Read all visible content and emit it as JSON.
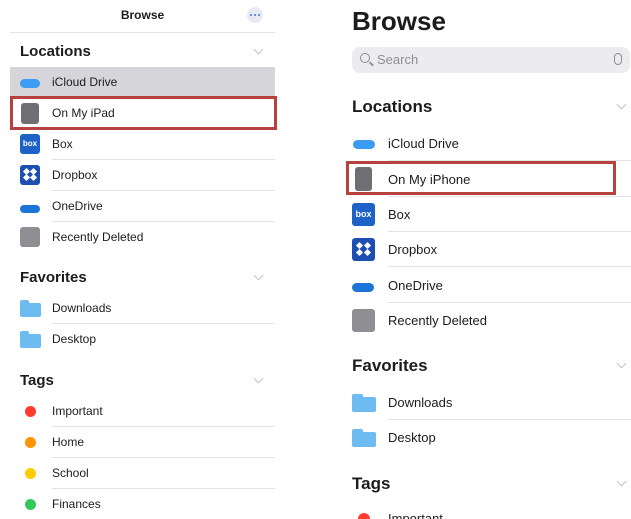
{
  "left": {
    "nav_title": "Browse",
    "sections": {
      "locations": {
        "title": "Locations",
        "items": [
          "iCloud Drive",
          "On My iPad",
          "Box",
          "Dropbox",
          "OneDrive",
          "Recently Deleted"
        ]
      },
      "favorites": {
        "title": "Favorites",
        "items": [
          "Downloads",
          "Desktop"
        ]
      },
      "tags": {
        "title": "Tags",
        "items": [
          "Important",
          "Home",
          "School",
          "Finances"
        ]
      }
    }
  },
  "right": {
    "large_title": "Browse",
    "search_placeholder": "Search",
    "sections": {
      "locations": {
        "title": "Locations",
        "items": [
          "iCloud Drive",
          "On My iPhone",
          "Box",
          "Dropbox",
          "OneDrive",
          "Recently Deleted"
        ]
      },
      "favorites": {
        "title": "Favorites",
        "items": [
          "Downloads",
          "Desktop"
        ]
      },
      "tags": {
        "title": "Tags",
        "items": [
          "Important"
        ]
      }
    }
  },
  "icons": {
    "icloud": "icloud-icon",
    "device": "ipad-icon",
    "box": "box-icon",
    "dropbox": "dropbox-icon",
    "onedrive": "onedrive-icon",
    "trash": "trash-icon",
    "folder": "folder-icon"
  },
  "box_logo_text": "box",
  "colors": {
    "highlight": "#b5423f",
    "selected_row": "#d6d6da",
    "tag_important": "#ff3b30",
    "tag_home": "#ff9500",
    "tag_school": "#ffcc00",
    "tag_finances": "#34c759",
    "accent": "#4a6fd0"
  }
}
